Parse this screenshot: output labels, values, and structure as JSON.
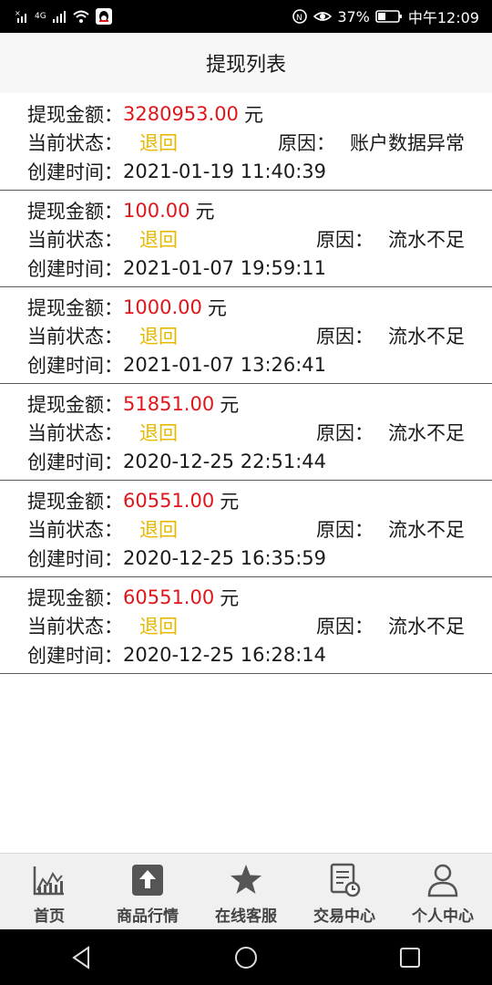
{
  "status_bar": {
    "network": "4G",
    "battery": "37%",
    "time": "中午12:09"
  },
  "header": {
    "title": "提现列表"
  },
  "labels": {
    "amount": "提现金额：",
    "status": "当前状态：",
    "reason": "原因：",
    "created": "创建时间：",
    "unit": "元"
  },
  "records": [
    {
      "amount": "3280953.00",
      "status": "退回",
      "reason": "账户数据异常",
      "created": "2021-01-19 11:40:39"
    },
    {
      "amount": "100.00",
      "status": "退回",
      "reason": "流水不足",
      "created": "2021-01-07 19:59:11"
    },
    {
      "amount": "1000.00",
      "status": "退回",
      "reason": "流水不足",
      "created": "2021-01-07 13:26:41"
    },
    {
      "amount": "51851.00",
      "status": "退回",
      "reason": "流水不足",
      "created": "2020-12-25 22:51:44"
    },
    {
      "amount": "60551.00",
      "status": "退回",
      "reason": "流水不足",
      "created": "2020-12-25 16:35:59"
    },
    {
      "amount": "60551.00",
      "status": "退回",
      "reason": "流水不足",
      "created": "2020-12-25 16:28:14"
    }
  ],
  "tabs": [
    {
      "label": "首页",
      "icon": "chart-icon"
    },
    {
      "label": "商品行情",
      "icon": "upload-icon"
    },
    {
      "label": "在线客服",
      "icon": "star-icon"
    },
    {
      "label": "交易中心",
      "icon": "document-clock-icon"
    },
    {
      "label": "个人中心",
      "icon": "person-icon"
    }
  ],
  "colors": {
    "amount": "#e0161b",
    "status": "#e6b800",
    "header_bg": "#f7f7f7",
    "tabbar_bg": "#f0f0f0"
  }
}
